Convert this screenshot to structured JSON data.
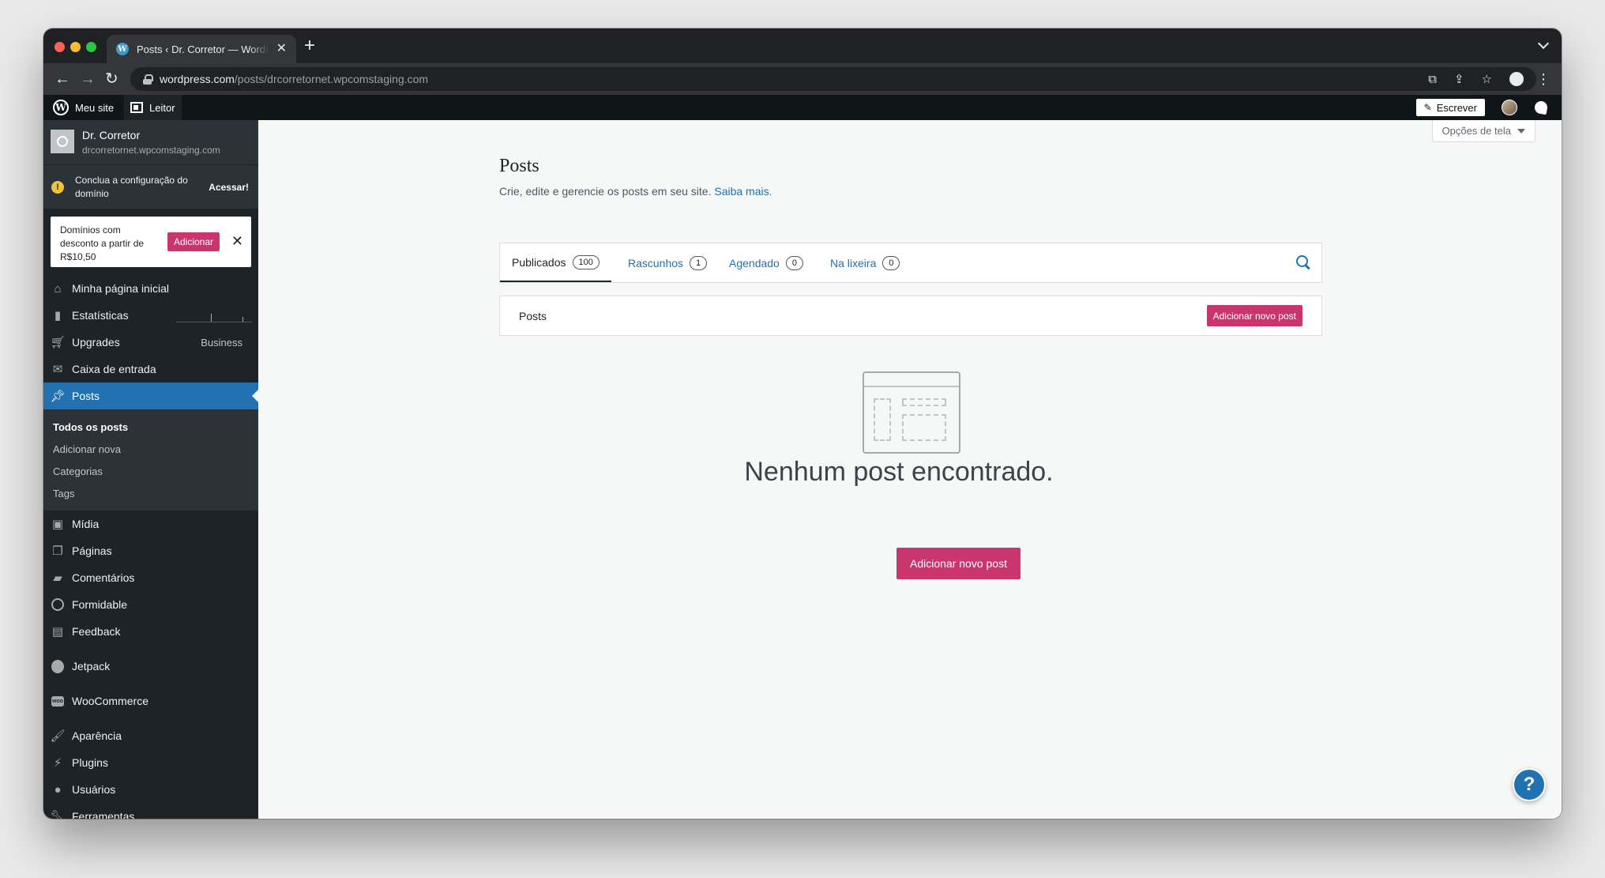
{
  "browser": {
    "tab_title": "Posts ‹ Dr. Corretor — WordPress.com",
    "url_host": "wordpress.com",
    "url_path": "/posts/drcorretornet.wpcomstaging.com"
  },
  "adminbar": {
    "my_site": "Meu site",
    "reader": "Leitor",
    "write": "Escrever"
  },
  "sidebar": {
    "site_name": "Dr. Corretor",
    "site_domain": "drcorretornet.wpcomstaging.com",
    "domain_notice": "Conclua a configuração do domínio",
    "domain_notice_link": "Acessar!",
    "promo_text": "Domínios com desconto a partir de R$10,50",
    "promo_button": "Adicionar",
    "items": {
      "home": "Minha página inicial",
      "stats": "Estatísticas",
      "upgrades": "Upgrades",
      "upgrades_plan": "Business",
      "inbox": "Caixa de entrada",
      "posts": "Posts",
      "media": "Mídia",
      "pages": "Páginas",
      "comments": "Comentários",
      "formidable": "Formidable",
      "feedback": "Feedback",
      "jetpack": "Jetpack",
      "woocommerce": "WooCommerce",
      "appearance": "Aparência",
      "plugins": "Plugins",
      "users": "Usuários",
      "tools": "Ferramentas"
    },
    "posts_sub": {
      "all": "Todos os posts",
      "add_new": "Adicionar nova",
      "categories": "Categorias",
      "tags": "Tags"
    }
  },
  "content": {
    "screen_options": "Opções de tela",
    "title": "Posts",
    "subtitle": "Crie, edite e gerencie os posts em seu site.",
    "learn_more": "Saiba mais.",
    "tabs": [
      {
        "label": "Publicados",
        "count": "100"
      },
      {
        "label": "Rascunhos",
        "count": "1"
      },
      {
        "label": "Agendado",
        "count": "0"
      },
      {
        "label": "Na lixeira",
        "count": "0"
      }
    ],
    "list_label": "Posts",
    "add_new_small": "Adicionar novo post",
    "empty_title": "Nenhum post encontrado.",
    "add_new_big": "Adicionar novo post",
    "help": "?"
  },
  "colors": {
    "accent": "#2271b1",
    "brand_pink": "#c9356e",
    "sidebar_bg": "#1d2327"
  }
}
